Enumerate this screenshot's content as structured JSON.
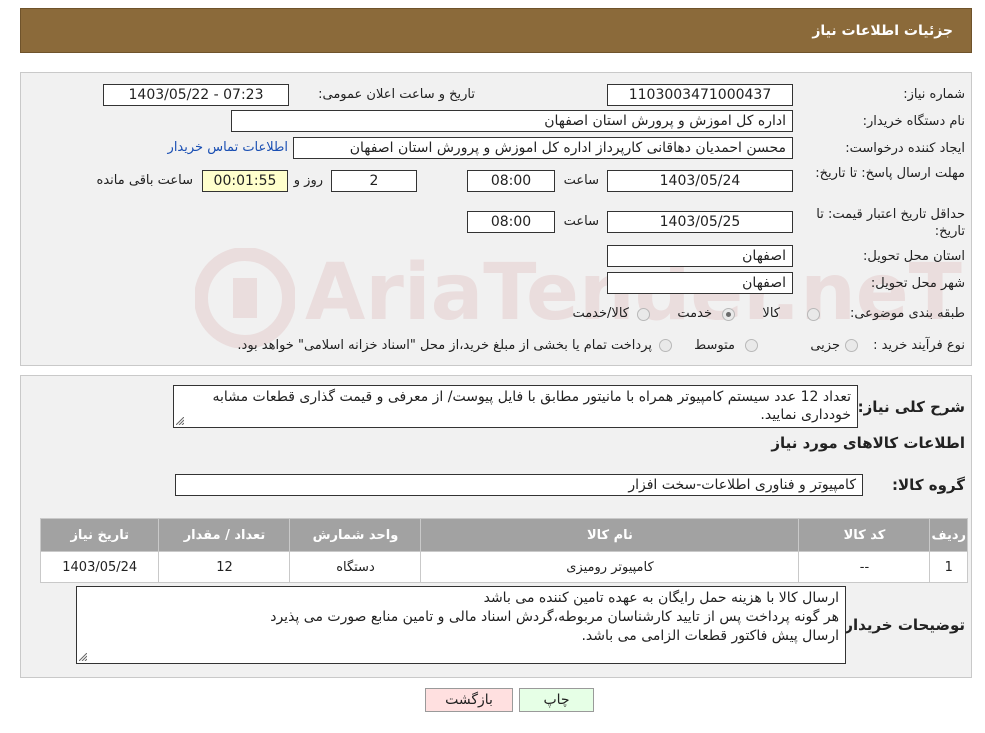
{
  "page": {
    "title": "جزئیات اطلاعات نیاز"
  },
  "fields": {
    "need_number_label": "شماره نیاز:",
    "need_number": "1103003471000437",
    "announce_label": "تاریخ و ساعت اعلان عمومی:",
    "announce_value": "1403/05/22 - 07:23",
    "buyer_label": "نام دستگاه خریدار:",
    "buyer_value": "اداره کل اموزش و پرورش استان اصفهان",
    "creator_label": "ایجاد کننده درخواست:",
    "creator_value": "محسن احمدیان دهاقانی کارپرداز اداره کل اموزش و پرورش استان اصفهان",
    "contact_link": "اطلاعات تماس خریدار",
    "reply_deadline_label": "مهلت ارسال پاسخ: تا تاریخ:",
    "reply_date": "1403/05/24",
    "time_label": "ساعت",
    "reply_time": "08:00",
    "days_value": "2",
    "days_label": "روز و",
    "remaining_value": "00:01:55",
    "remaining_label": "ساعت باقی مانده",
    "price_validity_label": "حداقل تاریخ اعتبار قیمت: تا تاریخ:",
    "price_date": "1403/05/25",
    "price_time": "08:00",
    "province_label": "استان محل تحویل:",
    "province_value": "اصفهان",
    "city_label": "شهر محل تحویل:",
    "city_value": "اصفهان",
    "category_label": "طبقه بندی موضوعی:",
    "category_options": [
      "کالا",
      "خدمت",
      "کالا/خدمت"
    ],
    "category_selected": "کالا",
    "process_label": "نوع فرآیند خرید :",
    "process_options": [
      "جزیی",
      "متوسط"
    ],
    "process_note": "پرداخت تمام یا بخشی از مبلغ خرید،از محل \"اسناد خزانه اسلامی\" خواهد بود."
  },
  "description": {
    "label": "شرح کلی نیاز:",
    "text": "تعداد 12 عدد سیستم کامپیوتر همراه با مانیتور مطابق با فایل پیوست/ از معرفی و قیمت گذاری قطعات مشابه خودداری نمایید."
  },
  "goods": {
    "section_title": "اطلاعات کالاهای مورد نیاز",
    "group_label": "گروه کالا:",
    "group_value": "کامپیوتر و فناوری اطلاعات-سخت افزار",
    "columns": [
      "ردیف",
      "کد کالا",
      "نام کالا",
      "واحد شمارش",
      "تعداد / مقدار",
      "تاریخ نیاز"
    ],
    "rows": [
      [
        "1",
        "--",
        "کامپیوتر رومیزی",
        "دستگاه",
        "12",
        "1403/05/24"
      ]
    ]
  },
  "buyer_notes": {
    "label": "توضیحات خریدار:",
    "lines": [
      "ارسال کالا با هزینه حمل رایگان به عهده تامین کننده می باشد",
      "هر گونه پرداخت پس از تایید کارشناسان مربوطه،گردش اسناد مالی و تامین منابع صورت می پذیرد",
      "ارسال پیش فاکتور قطعات الزامی می باشد."
    ]
  },
  "buttons": {
    "back": "بازگشت",
    "print": "چاپ"
  },
  "watermark": "AriaTender.neT",
  "colors": {
    "header_bg": "#8b6a3a",
    "table_header": "#a2a2a2",
    "back_button_bg": "#ffe0e0",
    "print_button_bg": "#e6ffe6",
    "link": "#1a4fb3"
  }
}
